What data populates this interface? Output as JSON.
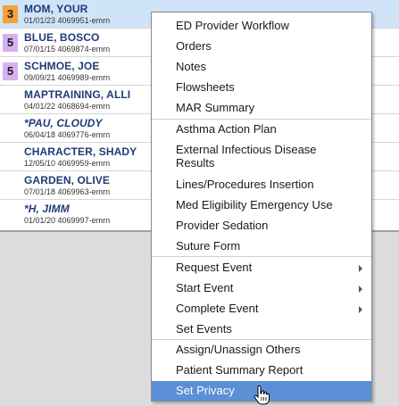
{
  "patients": [
    {
      "acuity": "3",
      "acuity_color": "#f4a23a",
      "name": "MOM, YOUR",
      "info": "01/01/23 4069951-emrn",
      "selected": true
    },
    {
      "acuity": "5",
      "acuity_color": "#d7b1ee",
      "name": "BLUE, BOSCO",
      "info": "07/01/15 4069874-emrn"
    },
    {
      "acuity": "5",
      "acuity_color": "#d7b1ee",
      "name": "SCHMOE, JOE",
      "info": "09/09/21 4069989-emrn"
    },
    {
      "acuity": "",
      "name": "MAPTRAINING, ALLI",
      "info": "04/01/22 4068694-emrn"
    },
    {
      "acuity": "",
      "name": "*PAU, CLOUDY",
      "info": "06/04/18 4069776-emrn",
      "italic": true
    },
    {
      "acuity": "",
      "name": "CHARACTER, SHADY",
      "info": "12/05/10 4069959-emrn"
    },
    {
      "acuity": "",
      "name": "GARDEN, OLIVE",
      "info": "07/01/18 4069963-emrn"
    },
    {
      "acuity": "",
      "name": "*H, JIMM",
      "info": "01/01/20 4069997-emrn",
      "italic": true
    }
  ],
  "menu": {
    "items": [
      "ED Provider Workflow",
      "Orders",
      "Notes",
      "Flowsheets",
      "MAR Summary",
      "Asthma Action Plan",
      "External Infectious Disease Results",
      "Lines/Procedures Insertion",
      "Med Eligibility Emergency Use",
      "Provider Sedation",
      "Suture Form",
      "Request Event",
      "Start Event",
      "Complete Event",
      "Set Events",
      "Assign/Unassign Others",
      "Patient Summary Report",
      "Set Privacy"
    ],
    "highlight_color": "#5b8fd6"
  }
}
